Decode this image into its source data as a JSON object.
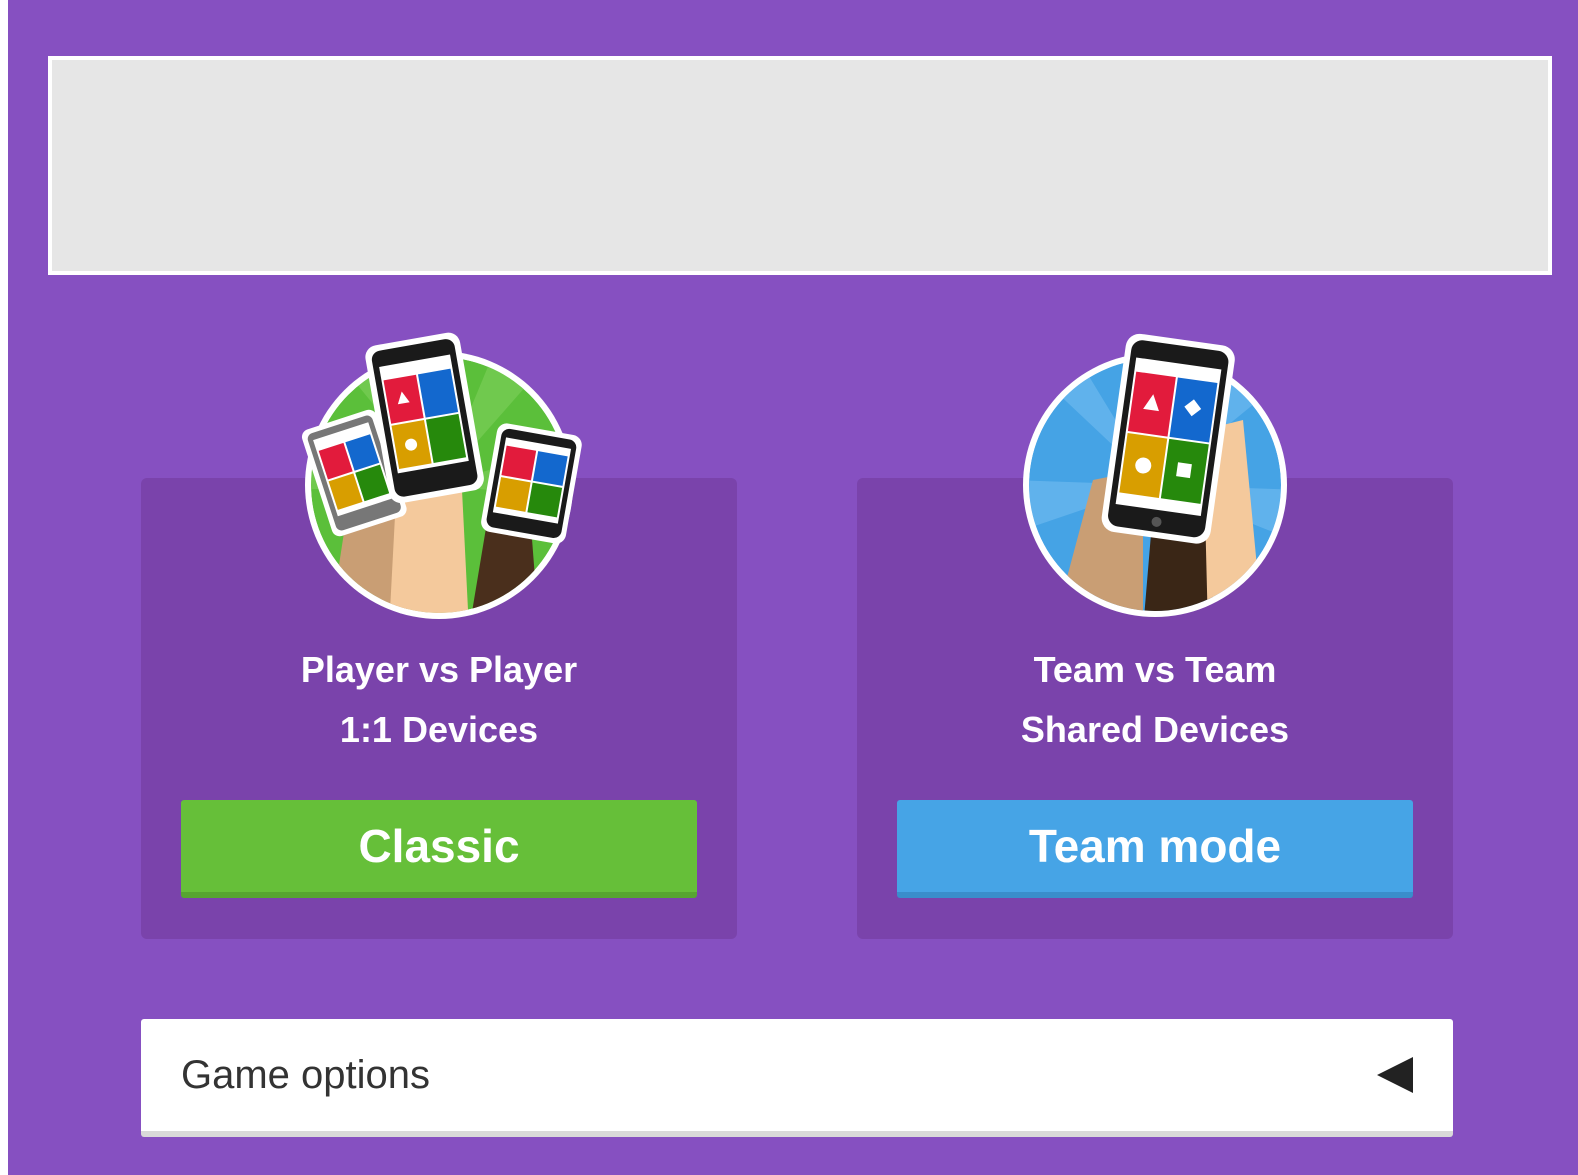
{
  "colors": {
    "background": "#8650c1",
    "card": "#7a43ab",
    "classic_button": "#66bf39",
    "team_button": "#46a4e6",
    "banner": "#e6e6e6"
  },
  "modes": [
    {
      "line1": "Player vs Player",
      "line2": "1:1 Devices",
      "button_label": "Classic",
      "icon": "classic-mode-illustration-icon"
    },
    {
      "line1": "Team vs Team",
      "line2": "Shared Devices",
      "button_label": "Team mode",
      "icon": "team-mode-illustration-icon"
    }
  ],
  "game_options": {
    "label": "Game options",
    "toggle_icon": "caret-left-icon"
  }
}
